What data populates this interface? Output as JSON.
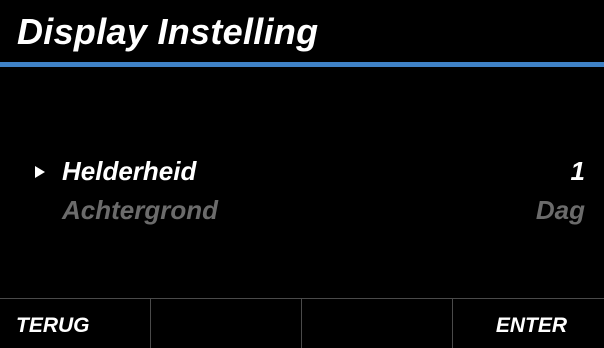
{
  "header": {
    "title": "Display Instelling"
  },
  "menu": {
    "items": [
      {
        "label": "Helderheid",
        "value": "1",
        "selected": true
      },
      {
        "label": "Achtergrond",
        "value": "Dag",
        "selected": false
      }
    ]
  },
  "softkeys": [
    {
      "label": "TERUG"
    },
    {
      "label": ""
    },
    {
      "label": ""
    },
    {
      "label": "ENTER"
    }
  ],
  "colors": {
    "accent": "#3f82c6",
    "background": "#000000",
    "text_active": "#ffffff",
    "text_inactive": "#6b6b6b"
  },
  "icons": {
    "selector": "triangle-right-icon"
  }
}
